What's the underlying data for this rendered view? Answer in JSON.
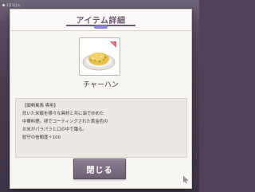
{
  "status_bar": {
    "text": "1月1日火"
  },
  "dialog": {
    "title": "アイテム詳細",
    "item": {
      "icon": "fried-rice-icon",
      "name": "チャーハン"
    },
    "description_lines": [
      "【御剣風馬 専用】",
      "炊いた米飯を様々な具材と共に油で炒めた",
      "中華料理。卵でコーティングされた黄金色の",
      "お米がパラパラと口の中で踊る。",
      "慰守の信頼度＋100"
    ],
    "close_label": "閉じる"
  },
  "colors": {
    "title": "#6a5a6f",
    "accent": "#8f86e0",
    "button": "#7d6f83"
  }
}
